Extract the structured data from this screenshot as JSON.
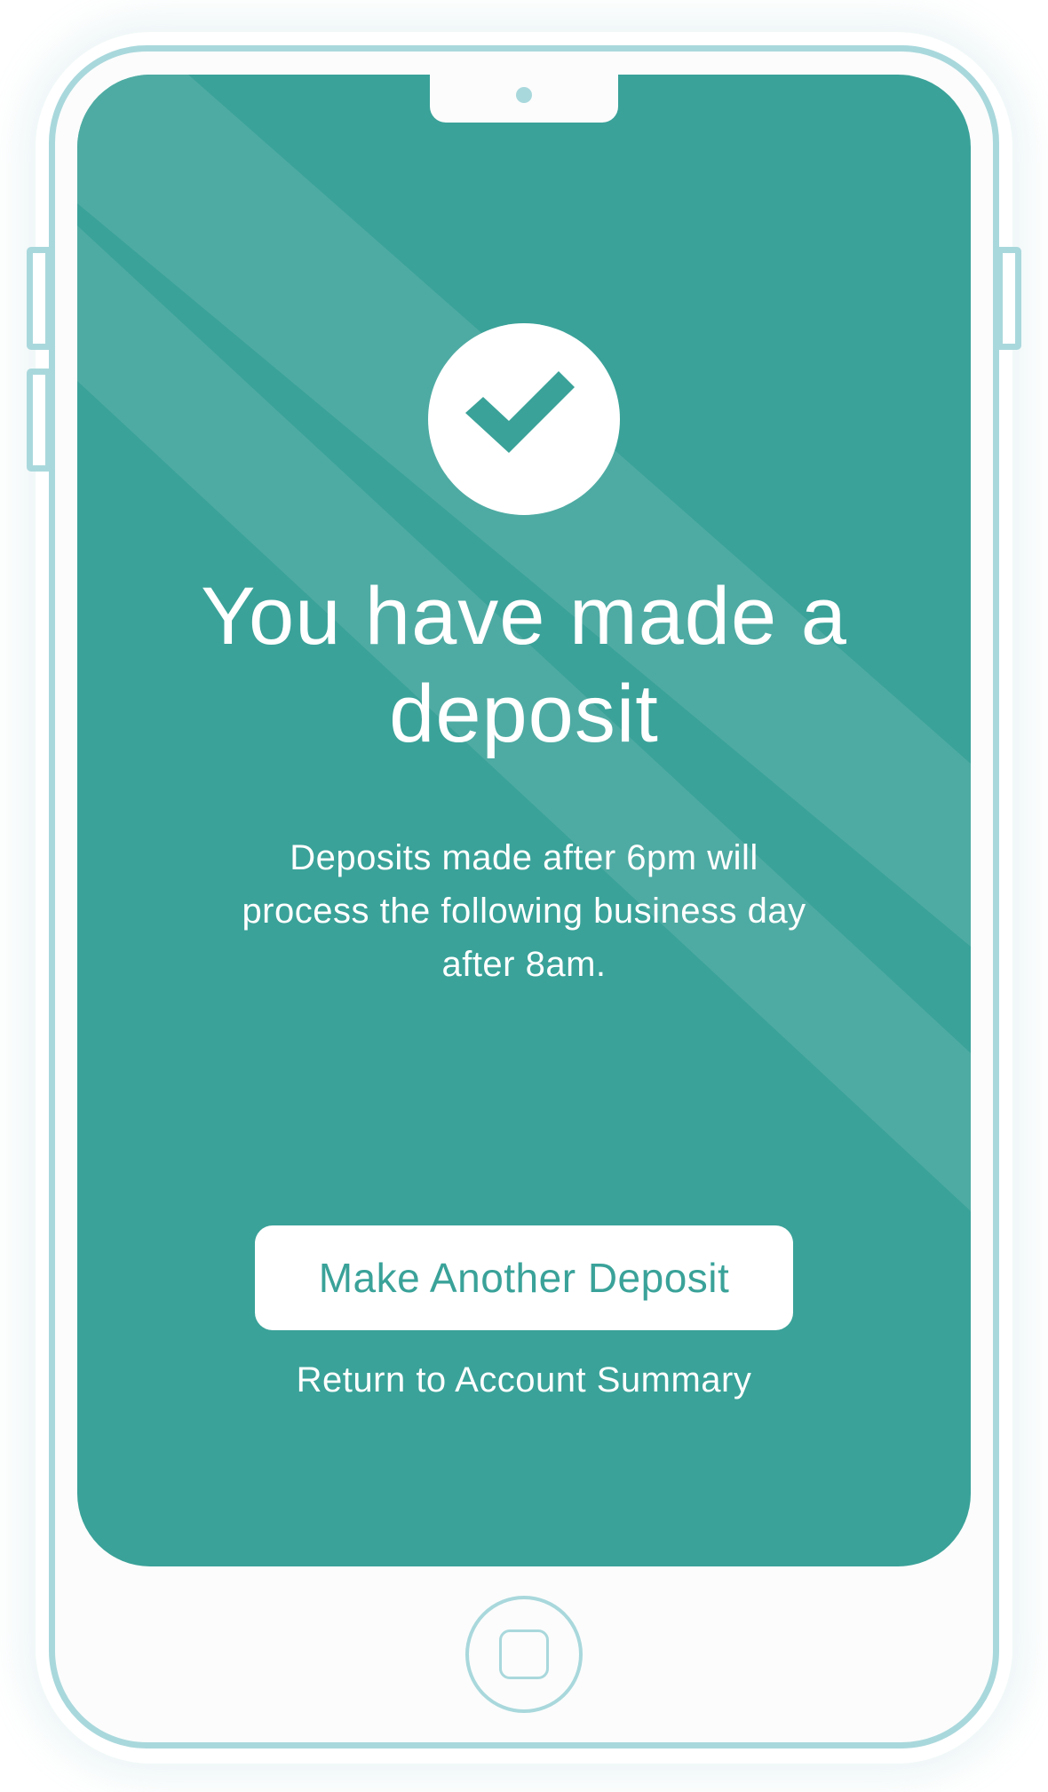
{
  "screen": {
    "title": "You have made a deposit",
    "message": "Deposits made after 6pm will process the following business day after 8am.",
    "primary_button_label": "Make Another Deposit",
    "secondary_link_label": "Return to Account Summary"
  },
  "icons": {
    "status": "checkmark-icon",
    "home": "home-button-icon"
  },
  "colors": {
    "accent": "#3aa299",
    "stripe": "#4eaba3",
    "device_outline": "#a9d8dc",
    "on_accent_text": "#ffffff"
  }
}
